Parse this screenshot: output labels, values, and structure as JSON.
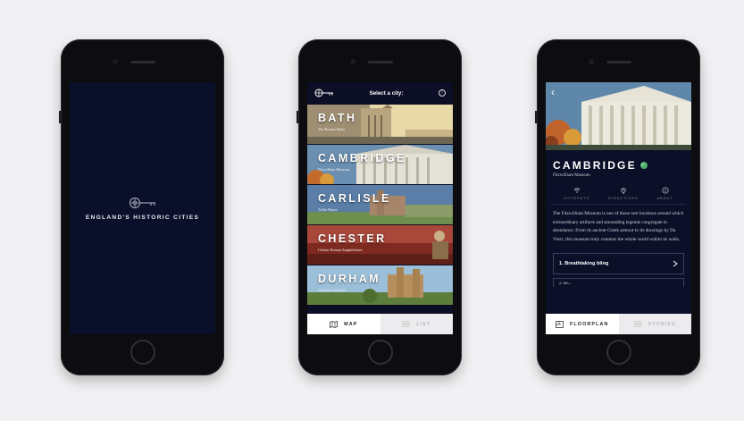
{
  "splash": {
    "title": "ENGLAND'S HISTORIC CITIES"
  },
  "city_list": {
    "header_title": "Select a city:",
    "cities": [
      {
        "name": "BATH",
        "subtitle": "The Roman Baths"
      },
      {
        "name": "CAMBRIDGE",
        "subtitle": "Fitzwilliam Museum"
      },
      {
        "name": "CARLISLE",
        "subtitle": "Tullie House"
      },
      {
        "name": "CHESTER",
        "subtitle": "Chester Roman Amphitheatre"
      },
      {
        "name": "DURHAM",
        "subtitle": "Durham Cathedral"
      }
    ],
    "tabs": [
      {
        "label": "MAP"
      },
      {
        "label": "LIST"
      }
    ]
  },
  "detail": {
    "title": "CAMBRIDGE",
    "subtitle": "Fitzwilliam Museum",
    "actions": [
      {
        "label": "HOTSPOTS"
      },
      {
        "label": "DIRECTIONS"
      },
      {
        "label": "ABOUT"
      }
    ],
    "description": "The Fitzwilliam Museum is one of those rare locations around which extraordinary artifacts and astounding legends congregate in abundance. From its ancient Greek armour to its drawings by Da Vinci, this museum truly contains the whole world within its walls.",
    "stories": [
      {
        "label": "1. Breathtaking bling"
      },
      {
        "label": "2. Wh..."
      }
    ],
    "tabs": [
      {
        "label": "FLOORPLAN"
      },
      {
        "label": "STORIES"
      }
    ]
  },
  "colors": {
    "navy": "#0a0f2a",
    "accent_green": "#4caf6e"
  }
}
